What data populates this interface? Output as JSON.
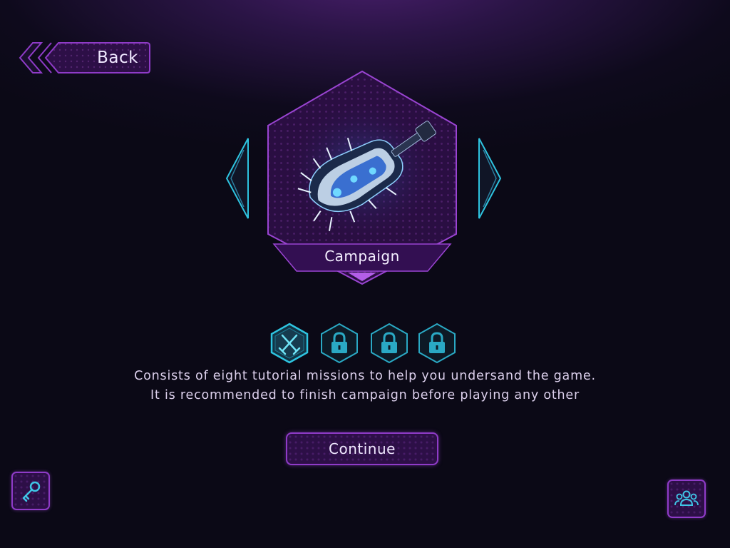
{
  "navigation": {
    "back_label": "Back"
  },
  "game_mode": {
    "title": "Campaign",
    "image": "spaceship-artwork"
  },
  "missions": [
    {
      "icon": "crossed-swords-icon",
      "state": "unlocked"
    },
    {
      "icon": "lock-icon",
      "state": "locked"
    },
    {
      "icon": "lock-icon",
      "state": "locked"
    },
    {
      "icon": "lock-icon",
      "state": "locked"
    }
  ],
  "description": {
    "line1": "Consists of eight tutorial missions to help you undersand the game.",
    "line2": "It is recommended to finish campaign before playing any other"
  },
  "actions": {
    "continue_label": "Continue"
  },
  "corner_buttons": {
    "left_icon": "key-icon",
    "right_icon": "people-icon"
  },
  "colors": {
    "accent_purple": "#8f3bc8",
    "accent_cyan": "#2ec4e0",
    "background": "#0e0a1c"
  }
}
